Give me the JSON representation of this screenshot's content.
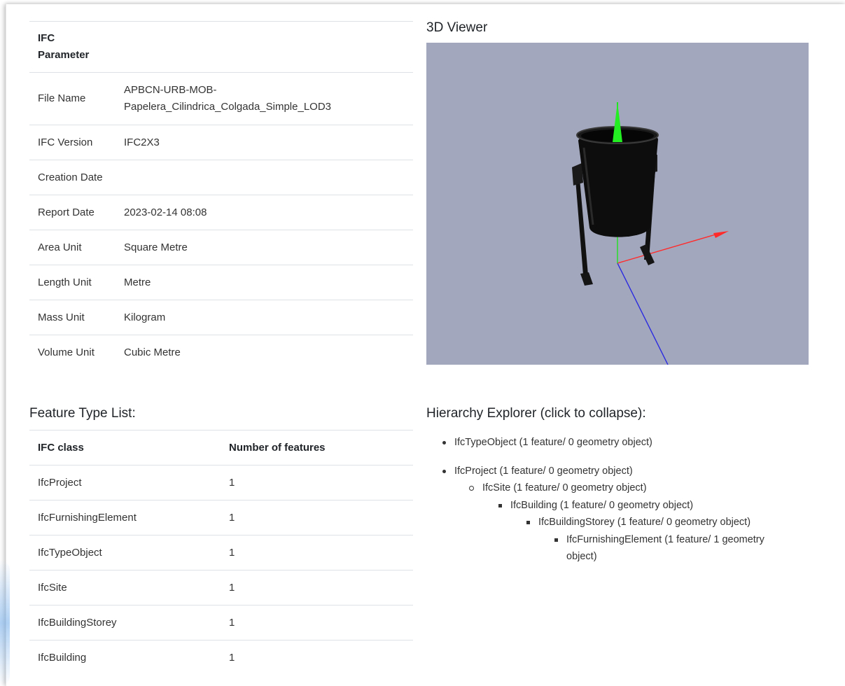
{
  "param_table": {
    "header": "IFC Parameter",
    "rows": [
      {
        "label": "File Name",
        "value": "APBCN-URB-MOB-Papelera_Cilindrica_Colgada_Simple_LOD3"
      },
      {
        "label": "IFC Version",
        "value": "IFC2X3"
      },
      {
        "label": "Creation Date",
        "value": ""
      },
      {
        "label": "Report Date",
        "value": "2023-02-14 08:08"
      },
      {
        "label": "Area Unit",
        "value": "Square Metre"
      },
      {
        "label": "Length Unit",
        "value": "Metre"
      },
      {
        "label": "Mass Unit",
        "value": "Kilogram"
      },
      {
        "label": "Volume Unit",
        "value": "Cubic Metre"
      }
    ]
  },
  "viewer": {
    "title": "3D Viewer",
    "background": "#a3a7bd",
    "axis_colors": {
      "x": "#ff2020",
      "y": "#20ff20",
      "z": "#2020ff"
    }
  },
  "feature_list": {
    "title": "Feature Type List:",
    "headers": [
      "IFC class",
      "Number of features"
    ],
    "rows": [
      {
        "class": "IfcProject",
        "count": "1"
      },
      {
        "class": "IfcFurnishingElement",
        "count": "1"
      },
      {
        "class": "IfcTypeObject",
        "count": "1"
      },
      {
        "class": "IfcSite",
        "count": "1"
      },
      {
        "class": "IfcBuildingStorey",
        "count": "1"
      },
      {
        "class": "IfcBuilding",
        "count": "1"
      }
    ]
  },
  "hierarchy": {
    "title": "Hierarchy Explorer (click to collapse):",
    "items": [
      "IfcTypeObject (1 feature/ 0 geometry object)",
      "IfcProject (1 feature/ 0 geometry object)",
      "IfcSite (1 feature/ 0 geometry object)",
      "IfcBuilding (1 feature/ 0 geometry object)",
      "IfcBuildingStorey (1 feature/ 0 geometry object)",
      "IfcFurnishingElement (1 feature/ 1 geometry object)"
    ]
  }
}
